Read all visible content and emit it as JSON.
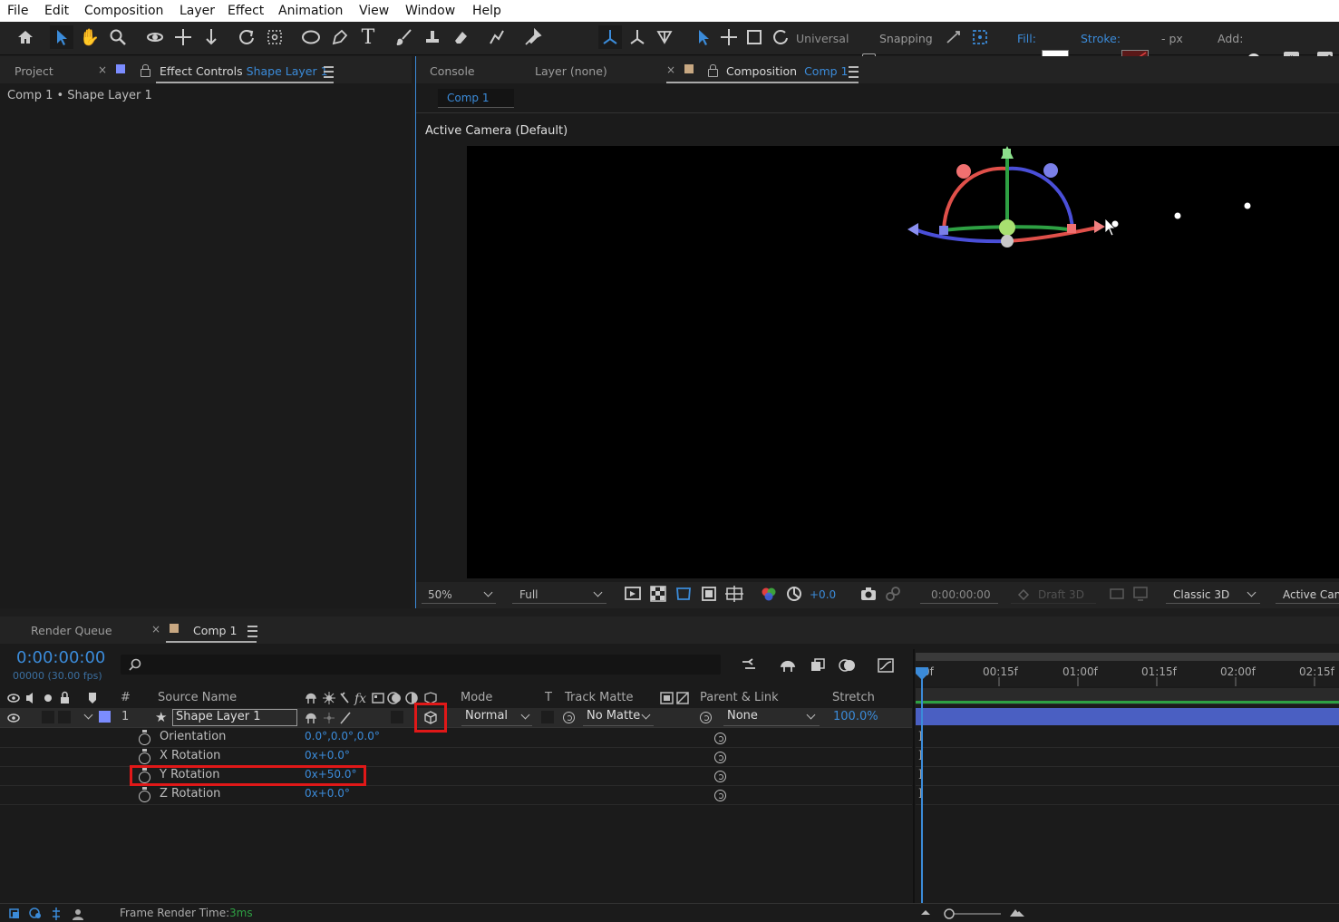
{
  "menu": [
    "File",
    "Edit",
    "Composition",
    "Layer",
    "Effect",
    "Animation",
    "View",
    "Window",
    "Help"
  ],
  "toolbar": {
    "universal_label": "Universal",
    "snapping_label": "Snapping",
    "fill_label": "Fill:",
    "stroke_label": "Stroke:",
    "px_label": "- px",
    "add_label": "Add:"
  },
  "left_panel": {
    "tab_project": "Project",
    "tab_effect_controls": "Effect Controls",
    "effect_controls_target": "Shape Layer 1",
    "breadcrumb": "Comp 1 • Shape Layer 1"
  },
  "viewer": {
    "tab_console": "Console",
    "tab_layer": "Layer (none)",
    "tab_composition": "Composition",
    "composition_name": "Comp 1",
    "sub_tab": "Comp 1",
    "camera_label": "Active Camera (Default)",
    "zoom": "50%",
    "resolution": "Full",
    "exposure": "+0.0",
    "timecode": "0:00:00:00",
    "draft3d": "Draft 3D",
    "renderer": "Classic 3D",
    "view_label": "Active Cam"
  },
  "timeline": {
    "tab_render_queue": "Render Queue",
    "tab_comp": "Comp 1",
    "current_time": "0:00:00:00",
    "frames_fps": "00000 (30.00 fps)",
    "search_placeholder": "",
    "col_num": "#",
    "col_source": "Source Name",
    "col_mode": "Mode",
    "col_t": "T",
    "col_trackmatte": "Track Matte",
    "col_parent": "Parent & Link",
    "col_stretch": "Stretch",
    "layer": {
      "num": "1",
      "name": "Shape Layer 1",
      "mode": "Normal",
      "matte": "No Matte",
      "parent": "None",
      "stretch": "100.0%"
    },
    "properties": [
      {
        "name": "Orientation",
        "value": "0.0°,0.0°,0.0°"
      },
      {
        "name": "X Rotation",
        "value": "0x+0.0°"
      },
      {
        "name": "Y Rotation",
        "value": "0x+50.0°"
      },
      {
        "name": "Z Rotation",
        "value": "0x+0.0°"
      }
    ],
    "ruler": [
      "0f",
      "00:15f",
      "01:00f",
      "01:15f",
      "02:00f",
      "02:15f"
    ],
    "status_label": "Frame Render Time:",
    "status_value": "3ms"
  },
  "colors": {
    "accent_blue": "#3b8bd9",
    "highlight_red": "#e01818",
    "layer_bar": "#4a5fc2",
    "label_color": "#7b8cff"
  }
}
